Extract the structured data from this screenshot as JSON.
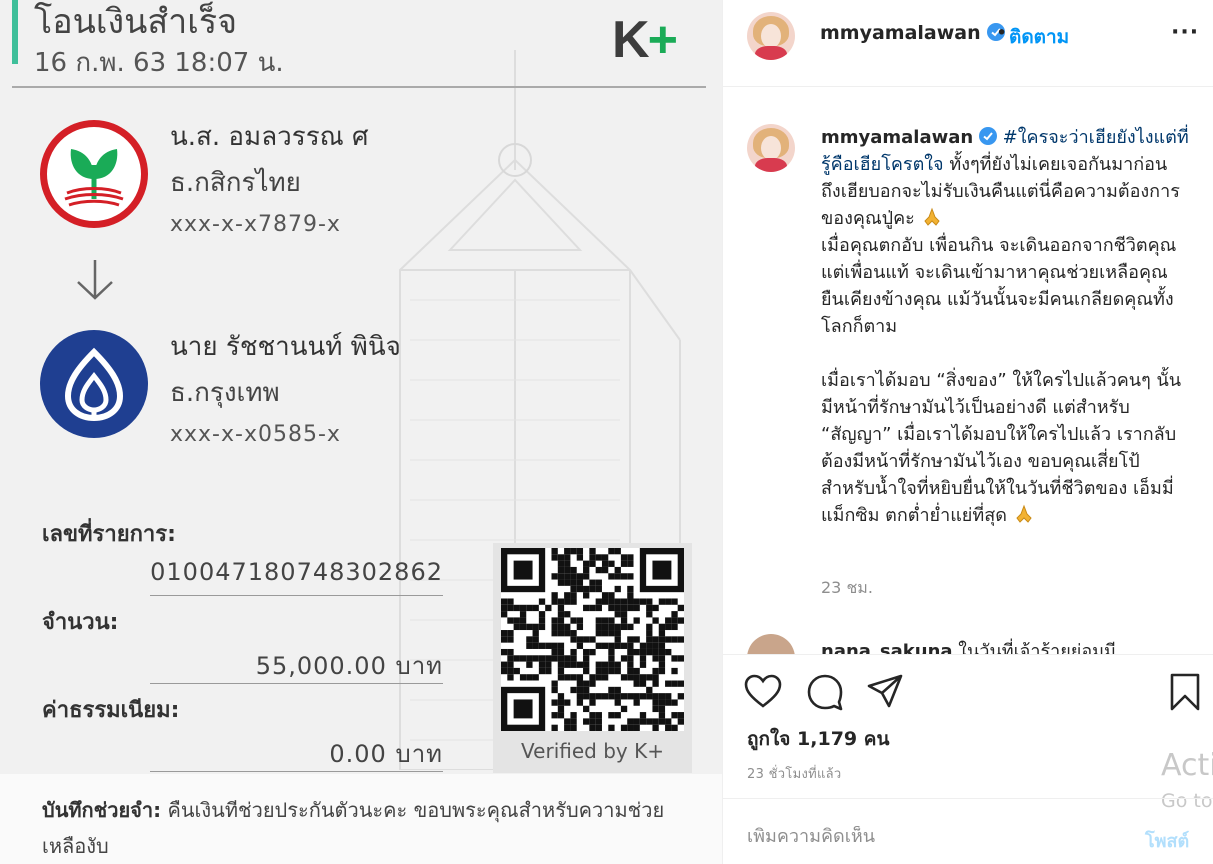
{
  "slip": {
    "title": "โอนเงินสำเร็จ",
    "date": "16 ก.พ. 63  18:07 น.",
    "logo_text_k": "K",
    "logo_text_plus": "+",
    "sender": {
      "name": "น.ส. อมลวรรณ ศ",
      "bank": "ธ.กสิกรไทย",
      "account": "xxx-x-x7879-x",
      "logo_icon": "kasikorn-bank-logo"
    },
    "receiver": {
      "name": "นาย รัชชานนท์ พินิจ",
      "bank": "ธ.กรุงเทพ",
      "account": "xxx-x-x0585-x",
      "logo_icon": "bangkok-bank-logo"
    },
    "transaction_label": "เลขที่รายการ:",
    "transaction_id": "010047180748302862",
    "amount_label": "จำนวน:",
    "amount": "55,000.00 บาท",
    "fee_label": "ค่าธรรมเนียม:",
    "fee": "0.00 บาท",
    "qr_caption": "Verified by K+",
    "memo_label": "บันทึกช่วยจำ:",
    "memo": "คืนเงินทีช่วยประกันตัวนะคะ ขอบพระคุณสำหรับความช่วยเหลืองับ"
  },
  "post": {
    "username": "mmyamalawan",
    "separator": "•",
    "follow_label": "ติดตาม",
    "more_label": "···",
    "caption": {
      "username": "mmyamalawan",
      "hashtags": "#ใครจะว่าเฮียยังไงแต่ที่รู้คือเฮียโครตใจ",
      "line1": "ทั้งๆที่ยังไม่เคยเจอกันมาก่อน ถึงเฮียบอกจะไม่รับเงินคืนแต่นี่คือความต้องการของคุณปู่คะ",
      "line2": "เมื่อคุณตกอับ เพื่อนกิน จะเดินออกจากชีวิตคุณ แต่เพื่อนแท้ จะเดินเข้ามาหาคุณช่วยเหลือคุณ ยืนเคียงข้างคุณ แม้วันนั้นจะมีคนเกลียดคุณทั้งโลกก็ตาม",
      "line3": "เมื่อเราได้มอบ “สิ่งของ” ให้ใครไปแล้วคนๆ นั้นมีหน้าที่รักษามันไว้เป็นอย่างดี แต่สำหรับ “สัญญา” เมื่อเราได้มอบให้ใครไปแล้ว เรากลับต้องมีหน้าที่รักษามันไว้เอง ขอบคุณเสี่ยโป้ สำหรับน้ำใจที่หยิบยื่นให้ในวันที่ชีวิตของ เอ็มมี่ แม็กซิม ตกต่ำย่ำแย่ที่สุด",
      "time": "23 ชม."
    },
    "next_comment": {
      "username": "nana_sakuna",
      "text": "ในวันที่เจ้าร้ายย่อมมี"
    },
    "actions": {
      "like_icon": "heart-icon",
      "comment_icon": "comment-icon",
      "share_icon": "paper-plane-icon",
      "save_icon": "bookmark-icon"
    },
    "likes": "ถูกใจ 1,179 คน",
    "posted_time": "23 ชั่วโมงที่แล้ว",
    "comment_placeholder": "เพิ่มความคิดเห็น",
    "post_button": "โพสต์"
  },
  "windows_watermark": {
    "line1": "Activ",
    "line2": "Go to"
  },
  "colors": {
    "accent_blue": "#0095f6",
    "kbank_green": "#1aab57",
    "kbank_red": "#d41f26",
    "bbl_blue": "#1f3f91",
    "slip_teal": "#3fbf9a"
  }
}
